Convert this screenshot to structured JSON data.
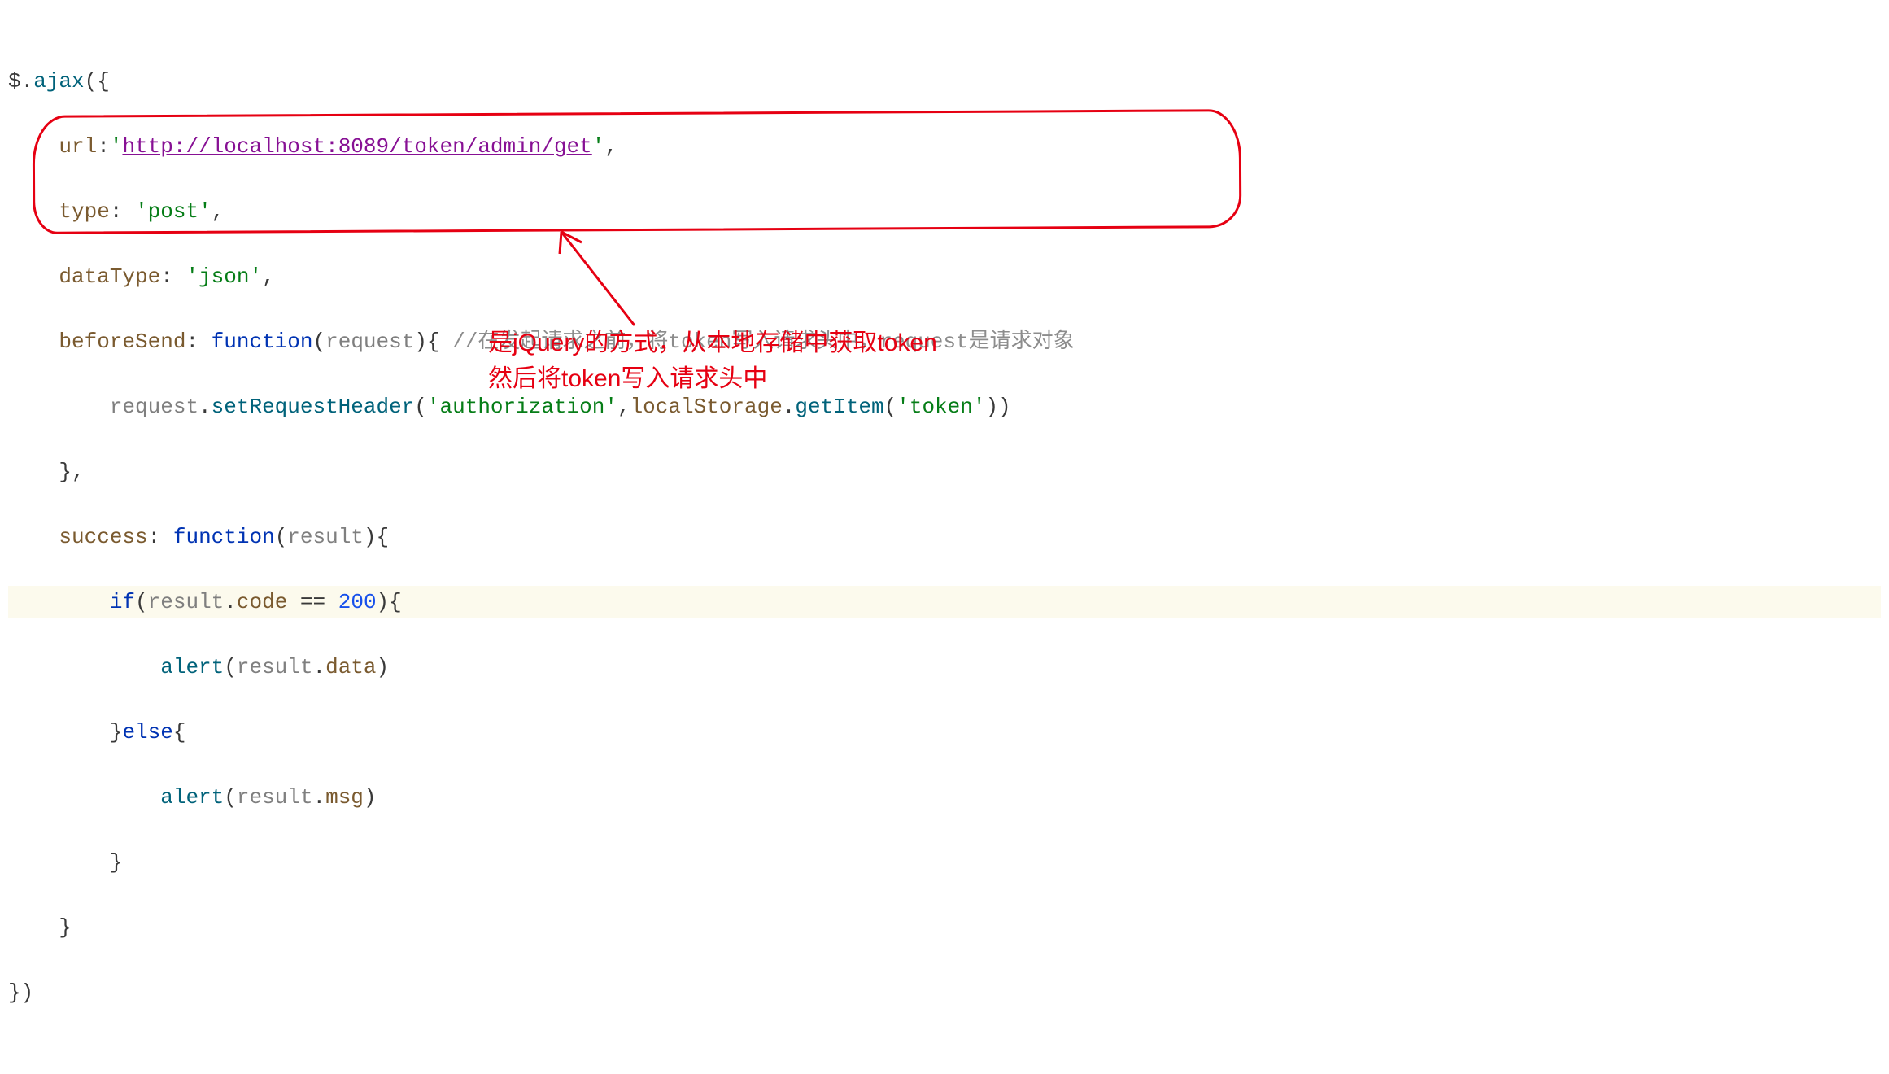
{
  "code": {
    "l1": {
      "a": "$.",
      "b": "ajax",
      "c": "({"
    },
    "l2": {
      "a": "    ",
      "b": "url",
      "c": ":",
      "d": "'",
      "e": "http://localhost:8089/token/admin/get",
      "f": "'",
      "g": ","
    },
    "l3": {
      "a": "    ",
      "b": "type",
      "c": ": ",
      "d": "'post'",
      "e": ","
    },
    "l4": {
      "a": "    ",
      "b": "dataType",
      "c": ": ",
      "d": "'json'",
      "e": ","
    },
    "l5": {
      "a": "    ",
      "b": "beforeSend",
      "c": ": ",
      "d": "function",
      "e": "(",
      "f": "request",
      "g": "){ ",
      "h": "//在发起请求之前，将token写入请求头中，request是请求对象"
    },
    "l6": {
      "a": "        ",
      "b": "request",
      "c": ".",
      "d": "setRequestHeader",
      "e": "(",
      "f": "'authorization'",
      "g": ",",
      "h": "localStorage",
      "i": ".",
      "j": "getItem",
      "k": "(",
      "l": "'token'",
      "m": "))"
    },
    "l7": {
      "a": "    },",
      "b": ""
    },
    "l8": {
      "a": "    ",
      "b": "success",
      "c": ": ",
      "d": "function",
      "e": "(",
      "f": "result",
      "g": "){"
    },
    "l9": {
      "a": "        ",
      "b": "if",
      "c": "(",
      "d": "result",
      "e": ".",
      "f": "code",
      "g": " == ",
      "h": "200",
      "i": "){"
    },
    "l10": {
      "a": "            ",
      "b": "alert",
      "c": "(",
      "d": "result",
      "e": ".",
      "f": "data",
      "g": ")"
    },
    "l11": {
      "a": "        }",
      "b": "else",
      "c": "{"
    },
    "l12": {
      "a": "            ",
      "b": "alert",
      "c": "(",
      "d": "result",
      "e": ".",
      "f": "msg",
      "g": ")"
    },
    "l13": {
      "a": "        }"
    },
    "l14": {
      "a": "    }"
    },
    "l15": {
      "a": "})"
    }
  },
  "annotation": {
    "line1": "是jQuery的方式，从本地存储中获取token",
    "line2": "然后将token写入请求头中"
  }
}
